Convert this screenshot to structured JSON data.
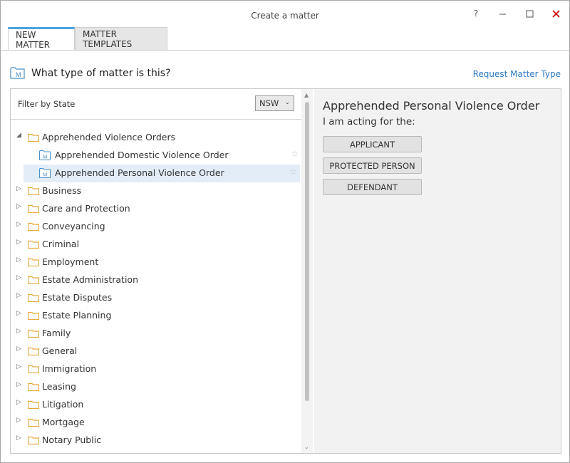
{
  "window": {
    "title": "Create a matter"
  },
  "controls": {
    "help": "?",
    "minimize": "—",
    "maximize": "☐",
    "close": "✕"
  },
  "tabs": [
    {
      "label": "NEW MATTER"
    },
    {
      "label": "MATTER TEMPLATES"
    }
  ],
  "header": {
    "question": "What type of matter is this?",
    "request_link": "Request Matter Type"
  },
  "filter": {
    "label": "Filter by State",
    "selected": "NSW"
  },
  "tree": {
    "items": [
      {
        "label": "Apprehended Violence Orders",
        "expanded": true
      },
      {
        "label": "Apprehended Domestic Violence Order",
        "child": true
      },
      {
        "label": "Apprehended Personal Violence Order",
        "child": true,
        "selected": true
      },
      {
        "label": "Business"
      },
      {
        "label": "Care and Protection"
      },
      {
        "label": "Conveyancing"
      },
      {
        "label": "Criminal"
      },
      {
        "label": "Employment"
      },
      {
        "label": "Estate Administration"
      },
      {
        "label": "Estate Disputes"
      },
      {
        "label": "Estate Planning"
      },
      {
        "label": "Family"
      },
      {
        "label": "General"
      },
      {
        "label": "Immigration"
      },
      {
        "label": "Leasing"
      },
      {
        "label": "Litigation"
      },
      {
        "label": "Mortgage"
      },
      {
        "label": "Notary Public"
      }
    ]
  },
  "detail": {
    "title": "Apprehended Personal Violence Order",
    "subtitle": "I am acting for the:",
    "roles": [
      "APPLICANT",
      "PROTECTED PERSON",
      "DEFENDANT"
    ]
  },
  "colors": {
    "accent": "#4aa3df",
    "link": "#2d7ac4",
    "folder": "#e8a93a",
    "close": "#d00000"
  }
}
